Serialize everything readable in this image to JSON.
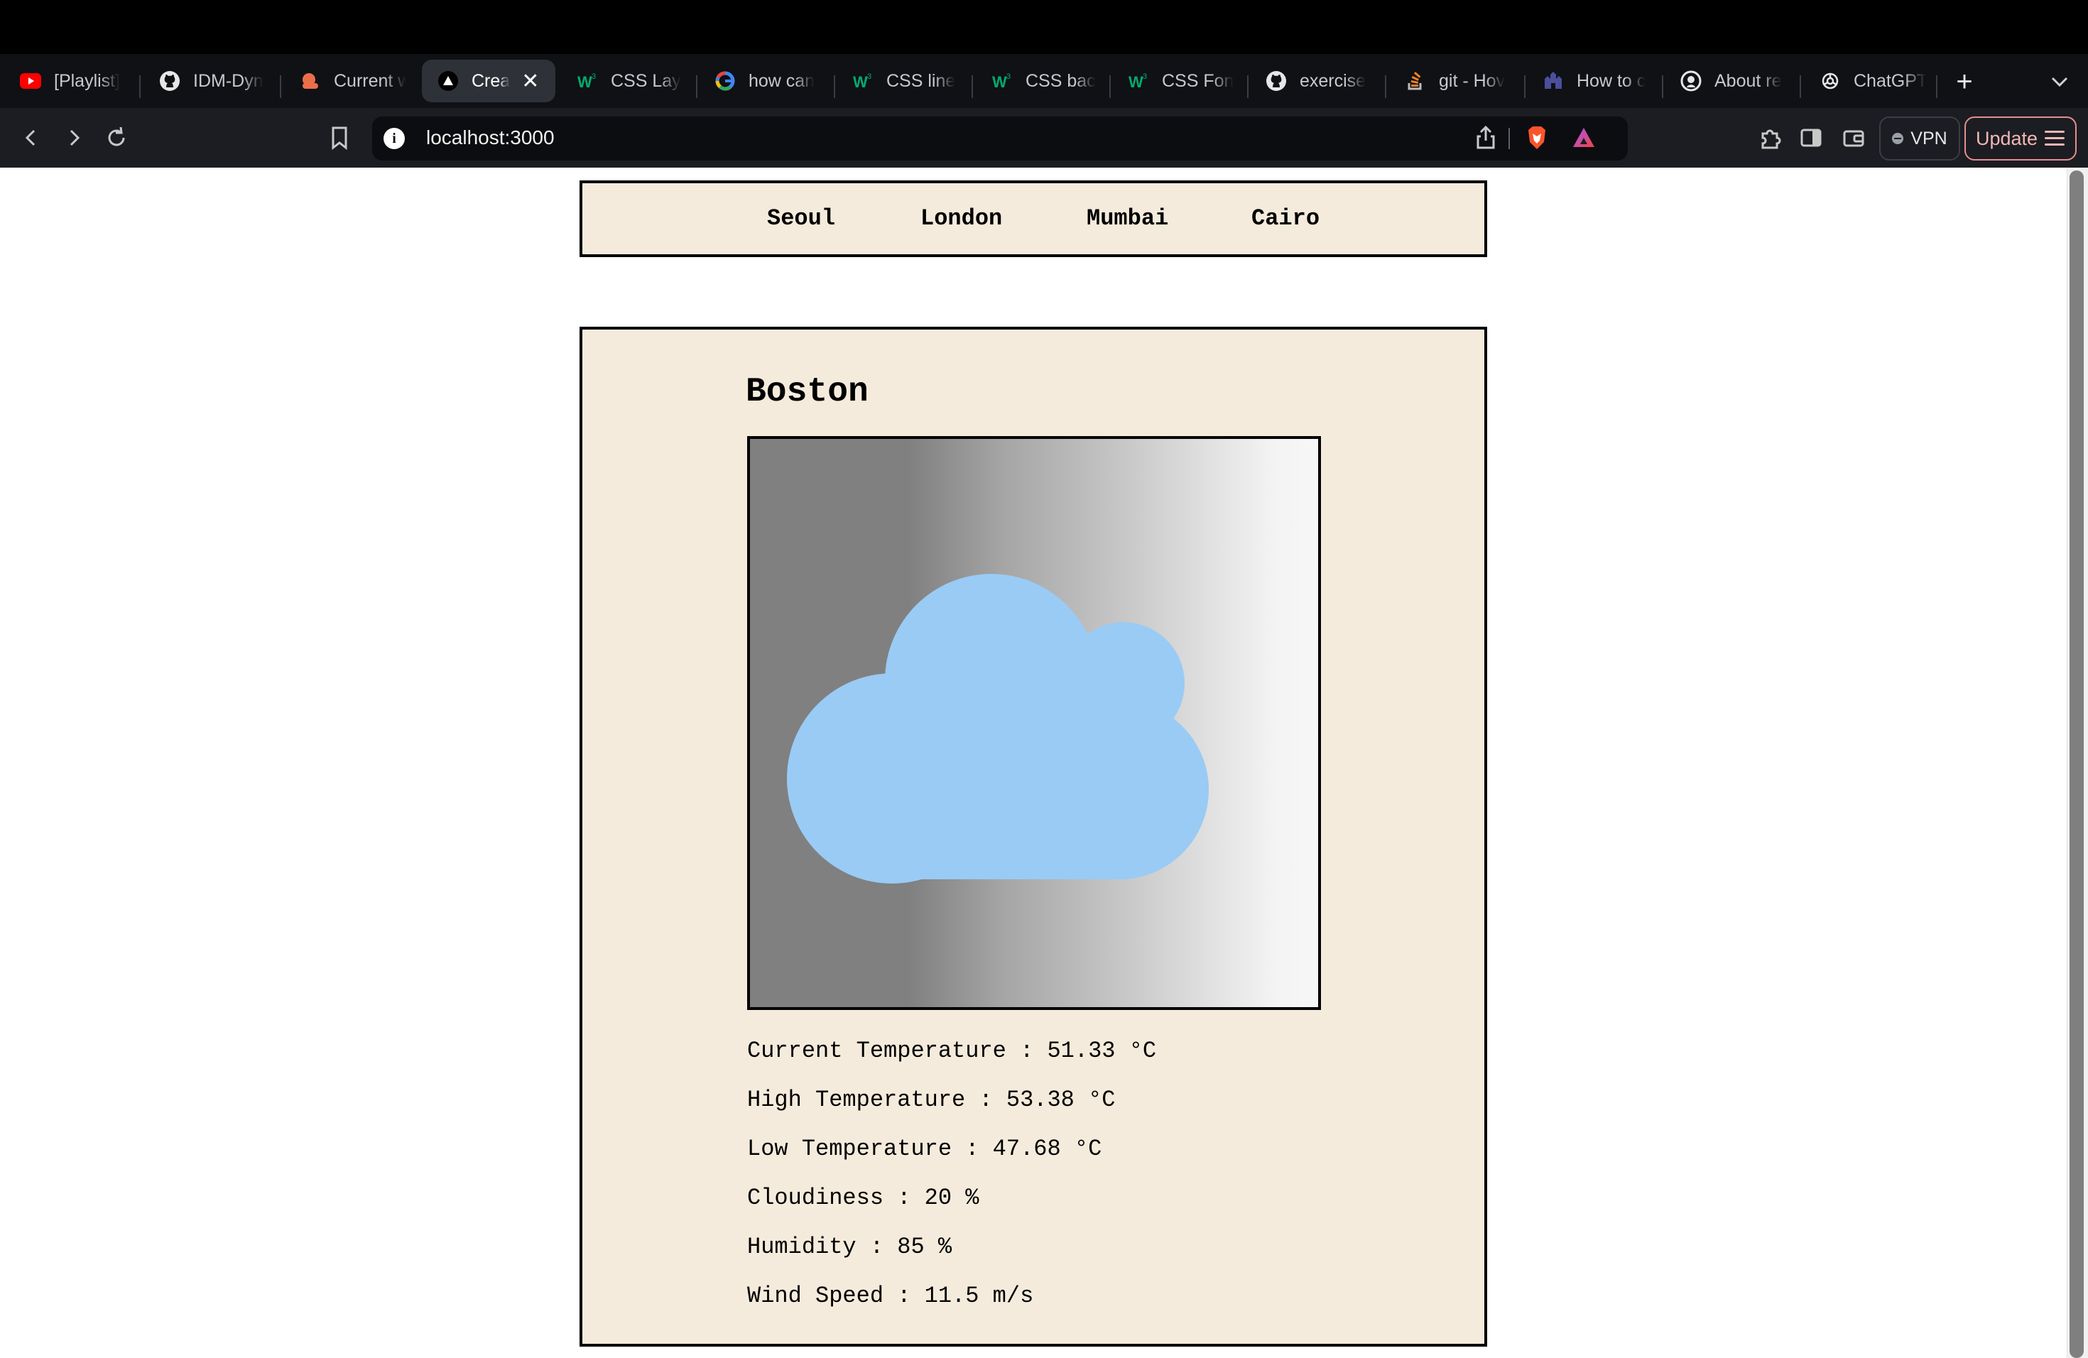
{
  "browser": {
    "tabs": [
      {
        "title": "[Playlist]",
        "icon": "youtube-icon",
        "active": false
      },
      {
        "title": "IDM-Dyn",
        "icon": "github-icon",
        "active": false
      },
      {
        "title": "Current w",
        "icon": "weather-site-icon",
        "active": false
      },
      {
        "title": "Crea",
        "icon": "vercel-icon",
        "active": true
      },
      {
        "title": "CSS Lay",
        "icon": "w3schools-icon",
        "active": false
      },
      {
        "title": "how can",
        "icon": "google-icon",
        "active": false
      },
      {
        "title": "CSS line",
        "icon": "w3schools-icon",
        "active": false
      },
      {
        "title": "CSS bac",
        "icon": "w3schools-icon",
        "active": false
      },
      {
        "title": "CSS Fon",
        "icon": "w3schools-icon",
        "active": false
      },
      {
        "title": "exercise",
        "icon": "github-icon",
        "active": false
      },
      {
        "title": "git - Hov",
        "icon": "stackoverflow-icon",
        "active": false
      },
      {
        "title": "How to c",
        "icon": "castle-icon",
        "active": false
      },
      {
        "title": "About re",
        "icon": "github-circle-icon",
        "active": false
      },
      {
        "title": "ChatGPT",
        "icon": "openai-icon",
        "active": false
      }
    ],
    "url": "localhost:3000",
    "vpn_label": "VPN",
    "update_label": "Update"
  },
  "nav": {
    "cities": [
      "Seoul",
      "London",
      "Mumbai",
      "Cairo"
    ]
  },
  "weather": {
    "city": "Boston",
    "condition_icon": "cloud-icon",
    "cloud_color": "#99cbf5",
    "stats": {
      "current_temp": "Current Temperature : 51.33 °C",
      "high_temp": "High Temperature : 53.38 °C",
      "low_temp": "Low Temperature : 47.68 °C",
      "cloudiness": "Cloudiness : 20 %",
      "humidity": "Humidity : 85 %",
      "wind_speed": "Wind Speed : 11.5 m/s"
    }
  },
  "colors": {
    "card_bg": "#f5ebdc",
    "border": "#000000"
  }
}
